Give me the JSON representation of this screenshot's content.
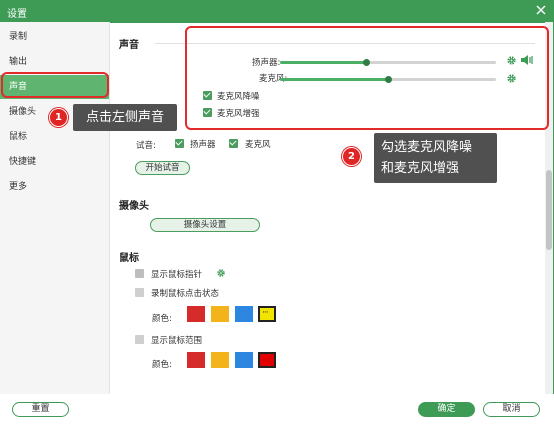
{
  "window": {
    "title": "设置"
  },
  "sidebar": {
    "items": [
      {
        "label": "录制"
      },
      {
        "label": "输出"
      },
      {
        "label": "声音"
      },
      {
        "label": "摄像头"
      },
      {
        "label": "鼠标"
      },
      {
        "label": "快捷键"
      },
      {
        "label": "更多"
      }
    ],
    "active_index": 2
  },
  "sound": {
    "title": "声音",
    "speaker_label": "扬声器:",
    "speaker_level": 0.4,
    "mic_label": "麦克风:",
    "mic_level": 0.5,
    "noise_reduction_label": "麦克风降噪",
    "noise_reduction_checked": true,
    "enhance_label": "麦克风增强",
    "enhance_checked": true,
    "test_label": "试音:",
    "test_speaker_label": "扬声器",
    "test_mic_label": "麦克风",
    "start_test_label": "开始试音"
  },
  "camera": {
    "title": "摄像头",
    "settings_label": "摄像头设置"
  },
  "mouse": {
    "title": "鼠标",
    "show_pointer_label": "显示鼠标指针",
    "record_click_label": "录制鼠标点击状态",
    "color_label": "颜色:",
    "click_colors": [
      "#d62b2b",
      "#f3b41b",
      "#2d86e0",
      "#f2e400"
    ],
    "show_range_label": "显示鼠标范围",
    "range_color_label": "颜色:",
    "range_colors": [
      "#d62b2b",
      "#f3b41b",
      "#2d86e0",
      "#e00000"
    ]
  },
  "footer": {
    "reset_label": "重置",
    "ok_label": "确定",
    "cancel_label": "取消"
  },
  "annotations": {
    "step1_number": "1",
    "step1_text": "点击左侧声音",
    "step2_number": "2",
    "step2_line1": "勾选麦克风降噪",
    "step2_line2": "和麦克风增强"
  },
  "colors": {
    "accent": "#3e9b56",
    "highlight": "#e22a2a"
  }
}
